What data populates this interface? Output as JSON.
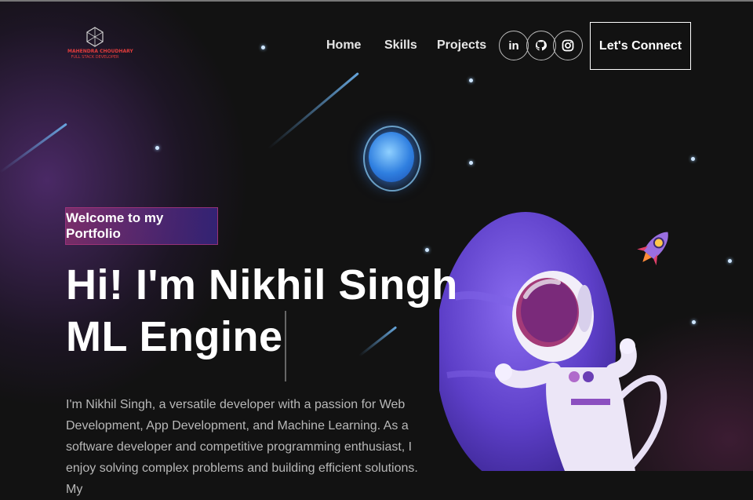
{
  "logo": {
    "line1": "MAHENDRA CHOUDHARY",
    "line2": "FULL STACK DEVELOPER"
  },
  "nav": {
    "links": [
      "Home",
      "Skills",
      "Projects"
    ],
    "social_icons": [
      "linkedin-icon",
      "github-icon",
      "instagram-icon"
    ],
    "social_labels": [
      "in",
      "",
      ""
    ],
    "cta_label": "Let's Connect"
  },
  "hero": {
    "tagline": "Welcome to my Portfolio",
    "heading_line1": "Hi! I'm Nikhil Singh",
    "heading_line2": "ML Engine",
    "description": "I'm Nikhil Singh, a versatile developer with a passion for Web Development, App Development, and Machine Learning. As a software developer and competitive programming enthusiast, I enjoy solving complex problems and building efficient solutions. My"
  },
  "colors": {
    "background": "#121212",
    "tagline_gradient_start": "#aa367c",
    "tagline_gradient_end": "#4a2fbd",
    "logo_text": "#e23c3c",
    "planet": "#6b4fd8"
  }
}
